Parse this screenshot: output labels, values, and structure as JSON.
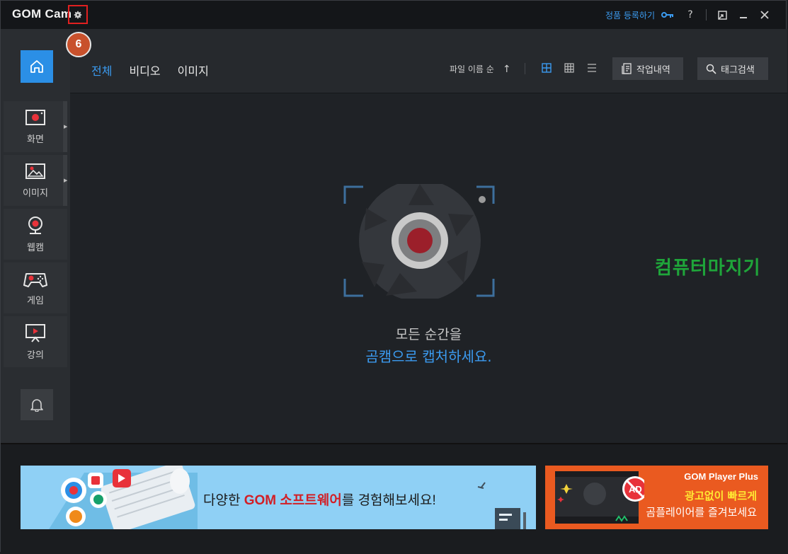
{
  "app": {
    "title": "GOM Cam"
  },
  "annotation": {
    "step": "6"
  },
  "titlebar": {
    "register_label": "정품 등록하기",
    "help_label": "?"
  },
  "sidebar": {
    "items": [
      {
        "label": "화면",
        "icon": "screen-record-icon"
      },
      {
        "label": "이미지",
        "icon": "image-icon"
      },
      {
        "label": "웹캠",
        "icon": "webcam-icon"
      },
      {
        "label": "게임",
        "icon": "gamepad-icon"
      },
      {
        "label": "강의",
        "icon": "lecture-icon"
      }
    ]
  },
  "header": {
    "tabs": [
      {
        "label": "전체",
        "active": true
      },
      {
        "label": "비디오",
        "active": false
      },
      {
        "label": "이미지",
        "active": false
      }
    ],
    "sort_label": "파일 이름 순",
    "sort_arrow": "↑",
    "job_history_label": "작업내역",
    "tag_search_label": "태그검색"
  },
  "main": {
    "message_line1": "모든 순간을",
    "message_line2": "곰캠으로 캡처하세요."
  },
  "watermark": {
    "text": "컴퓨터마지기"
  },
  "banners": {
    "gom_software": {
      "prefix": "다양한 ",
      "highlight": "GOM 소프트웨어",
      "suffix": "를 경험해보세요!"
    },
    "gom_player_plus": {
      "brand": "GOM Player Plus",
      "line1": "광고없이 빠르게",
      "line2": "곰플레이어를 즐겨보세요",
      "ad_mark": "AD"
    }
  },
  "colors": {
    "accent": "#2b8fe6",
    "annotation": "#c8512c",
    "highlight_border": "#e02020"
  }
}
